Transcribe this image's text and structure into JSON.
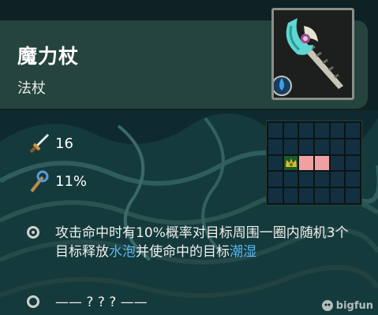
{
  "item": {
    "name": "魔力杖",
    "type": "法杖"
  },
  "stats": [
    {
      "icon": "sword-icon",
      "value": "16"
    },
    {
      "icon": "staff-crit-icon",
      "value": "11%"
    }
  ],
  "range_grid": {
    "cols": 6,
    "rows": 5,
    "self_cell": [
      1,
      2
    ],
    "hit_cells": [
      [
        2,
        2
      ],
      [
        3,
        2
      ]
    ],
    "colors": {
      "empty": "#123042",
      "hit": "#f0a0a2",
      "self": "#1a5a2a"
    }
  },
  "effects": [
    {
      "segments": [
        {
          "text": "攻击命中时有10%概率对目标周围一圈内随机3个目标释放",
          "kw": false
        },
        {
          "text": "水泡",
          "kw": true
        },
        {
          "text": "并使命中的目标",
          "kw": false
        },
        {
          "text": "潮湿",
          "kw": true
        }
      ]
    },
    {
      "segments": [
        {
          "text": "—— ? ? ? ——",
          "kw": false
        }
      ]
    }
  ],
  "watermark": "bigfun",
  "colors": {
    "keyword": "#58b8ee",
    "header_bg": "#26443e",
    "page_bg": "#0e2226"
  }
}
